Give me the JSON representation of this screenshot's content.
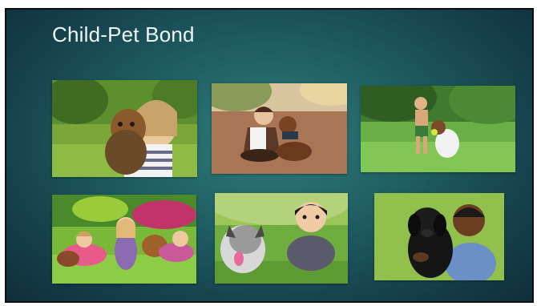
{
  "slide": {
    "title": "Child-Pet Bond"
  },
  "photos": [
    {
      "icon": "girl-with-yorkshire-terrier-photo"
    },
    {
      "icon": "child-with-dachshund-photo"
    },
    {
      "icon": "boy-playing-with-dog-photo"
    },
    {
      "icon": "girls-with-dogs-on-grass-photo"
    },
    {
      "icon": "child-with-schnauzer-photo"
    },
    {
      "icon": "boy-with-black-labrador-photo"
    }
  ],
  "colors": {
    "background_center": "#2f7d79",
    "background_edge": "#0d2a34",
    "title_text": "#eef6f6"
  }
}
